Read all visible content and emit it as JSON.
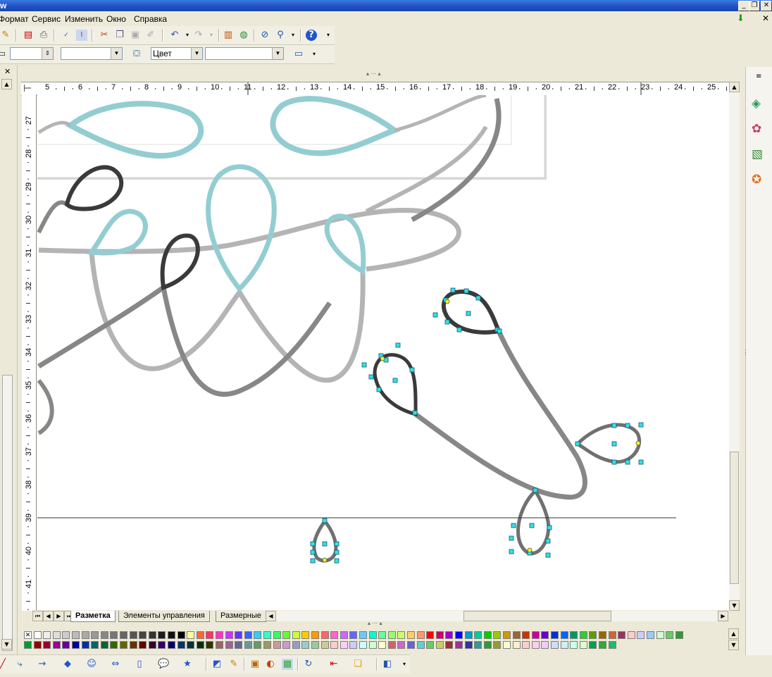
{
  "title_bar": {
    "title": "w",
    "min": "_",
    "max": "❐",
    "close": "✕"
  },
  "menu": [
    {
      "label": "Формат"
    },
    {
      "label": "Сервис"
    },
    {
      "label": "Изменить"
    },
    {
      "label": "Окно"
    },
    {
      "label": "Справка"
    }
  ],
  "menu_right": {
    "download": "⬇",
    "close": "✕"
  },
  "formatting": {
    "line_width": "",
    "line_style": "",
    "area_style": "Цвет",
    "area_fill": ""
  },
  "ruler_h": [
    "5",
    "6",
    "7",
    "8",
    "9",
    "10",
    "11",
    "12",
    "13",
    "14",
    "15",
    "16",
    "17",
    "18",
    "19",
    "20",
    "21",
    "22",
    "23",
    "24",
    "25"
  ],
  "ruler_v": [
    "27",
    "28",
    "29",
    "30",
    "31",
    "32",
    "33",
    "34",
    "35",
    "36",
    "37",
    "38",
    "39",
    "40",
    "41"
  ],
  "tabs": [
    "Разметка",
    "Элементы управления",
    "Размерные"
  ],
  "colors": {
    "gray_light": "#b4b4b4",
    "gray_mid": "#878787",
    "gray_dark": "#3a3a3a",
    "teal": "#93cdd1",
    "handle": "#33e0e6",
    "handle_yellow": "#f2f21a"
  },
  "palette_row1": [
    "#ffffff",
    "#eeeeee",
    "#dddddd",
    "#cccccc",
    "#bbbbbb",
    "#aaaaaa",
    "#999999",
    "#888888",
    "#777777",
    "#666666",
    "#555555",
    "#444444",
    "#333333",
    "#1c1c1c",
    "#111111",
    "#000000",
    "#ffff99",
    "#ff6633",
    "#ff3366",
    "#ff33cc",
    "#cc33ff",
    "#6633ff",
    "#3366ff",
    "#33ccff",
    "#33ffcc",
    "#33ff66",
    "#66ff33",
    "#ccff33",
    "#ffcc00",
    "#ff9900",
    "#ff6666",
    "#ff66cc",
    "#cc66ff",
    "#6666ff",
    "#66ccff",
    "#00ffcc",
    "#66ff99",
    "#99ff66",
    "#ccff66",
    "#ffcc66",
    "#ff9966",
    "#ff0000",
    "#cc0066",
    "#9900cc",
    "#0000ff",
    "#0099cc",
    "#00cc99",
    "#00cc00",
    "#99cc00",
    "#cc9900",
    "#996633",
    "#cc3300",
    "#cc0099",
    "#6600cc",
    "#0033cc",
    "#0066ff",
    "#009966",
    "#33cc33",
    "#669900",
    "#996600",
    "#cc6633",
    "#993366",
    "#ffcccc",
    "#ccccff",
    "#99ccff",
    "#ccffcc",
    "#66cc66",
    "#339933"
  ],
  "palette_row2": [
    "#009933",
    "#990000",
    "#990033",
    "#990099",
    "#660099",
    "#000099",
    "#003399",
    "#006666",
    "#006633",
    "#336600",
    "#666600",
    "#663300",
    "#660000",
    "#330033",
    "#330066",
    "#000066",
    "#003366",
    "#003333",
    "#003300",
    "#333300",
    "#996666",
    "#996699",
    "#666699",
    "#669999",
    "#669966",
    "#999966",
    "#cc9999",
    "#cc99cc",
    "#9999cc",
    "#99cccc",
    "#99cc99",
    "#cccc99",
    "#ffcccc",
    "#ffccff",
    "#ccccff",
    "#ccffff",
    "#ccffcc",
    "#ffffcc",
    "#cc6666",
    "#cc66cc",
    "#6666cc",
    "#66cccc",
    "#66cc66",
    "#cccc66",
    "#993333",
    "#993399",
    "#333399",
    "#339999",
    "#339933",
    "#999933",
    "#ffffcc",
    "#ffeecc",
    "#ffcccc",
    "#ffccee",
    "#eeccff",
    "#ccddff",
    "#cceeff",
    "#ccffee",
    "#ddffcc",
    "#00a050",
    "#33aa33",
    "#22bb66"
  ],
  "icons": {
    "toolbar1": [
      "edit-icon",
      "pdf-icon",
      "print-icon",
      "spellcheck-icon",
      "autospell-icon",
      "cut-icon",
      "copy-icon",
      "paste-icon",
      "format-paintbrush-icon",
      "undo-icon",
      "redo-icon",
      "chart-icon",
      "navigator-icon",
      "help-icon"
    ],
    "sidebar": [
      "properties-icon",
      "styles-icon",
      "gallery-icon",
      "navigator-icon"
    ],
    "drawbar": [
      "line-icon",
      "connector-icon",
      "arrow-icon",
      "diamond-icon",
      "smiley-icon",
      "double-arrow-icon",
      "rectangle-icon",
      "callout-icon",
      "star-icon",
      "points-icon",
      "pencil-icon",
      "textbox-icon",
      "shapes-icon",
      "fontwork-icon",
      "rotate-icon",
      "align-icon",
      "arrange-icon",
      "extrusion-icon"
    ]
  }
}
